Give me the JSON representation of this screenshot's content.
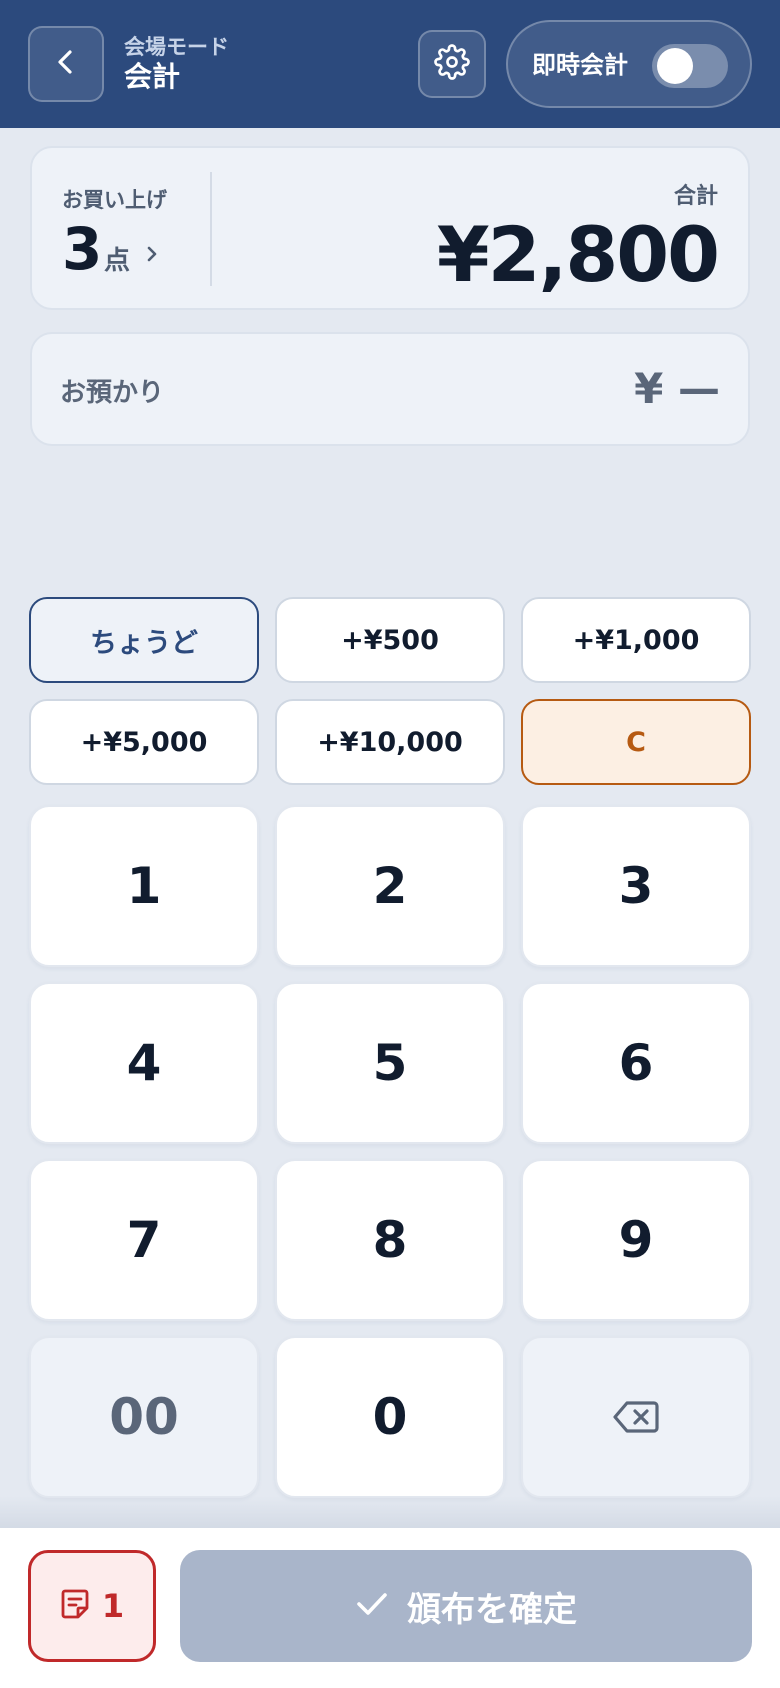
{
  "header": {
    "back_icon": "chevron-left-icon",
    "mode_label": "会場モード",
    "title": "会計",
    "settings_icon": "gear-icon",
    "instant_label": "即時会計",
    "instant_enabled": false
  },
  "summary": {
    "items_label": "お買い上げ",
    "items_count": "3",
    "items_unit": "点",
    "total_label": "合計",
    "total_value": "¥2,800"
  },
  "received": {
    "label": "お預かり",
    "value": "¥ —"
  },
  "quick": {
    "exact": "ちょうど",
    "add500": "+¥500",
    "add1000": "+¥1,000",
    "add5000": "+¥5,000",
    "add10000": "+¥10,000",
    "clear": "C"
  },
  "keypad": {
    "k1": "1",
    "k2": "2",
    "k3": "3",
    "k4": "4",
    "k5": "5",
    "k6": "6",
    "k7": "7",
    "k8": "8",
    "k9": "9",
    "k00": "00",
    "k0": "0",
    "backspace_icon": "backspace-icon"
  },
  "footer": {
    "ticket_icon": "note-icon",
    "ticket_count": "1",
    "confirm_icon": "check-icon",
    "confirm_label": "頒布を確定"
  },
  "colors": {
    "header_bg": "#2c4a7d",
    "page_bg": "#e4e9f1",
    "clear_accent": "#b65a12",
    "ticket_accent": "#c0292a",
    "confirm_disabled": "#a9b5ca"
  }
}
